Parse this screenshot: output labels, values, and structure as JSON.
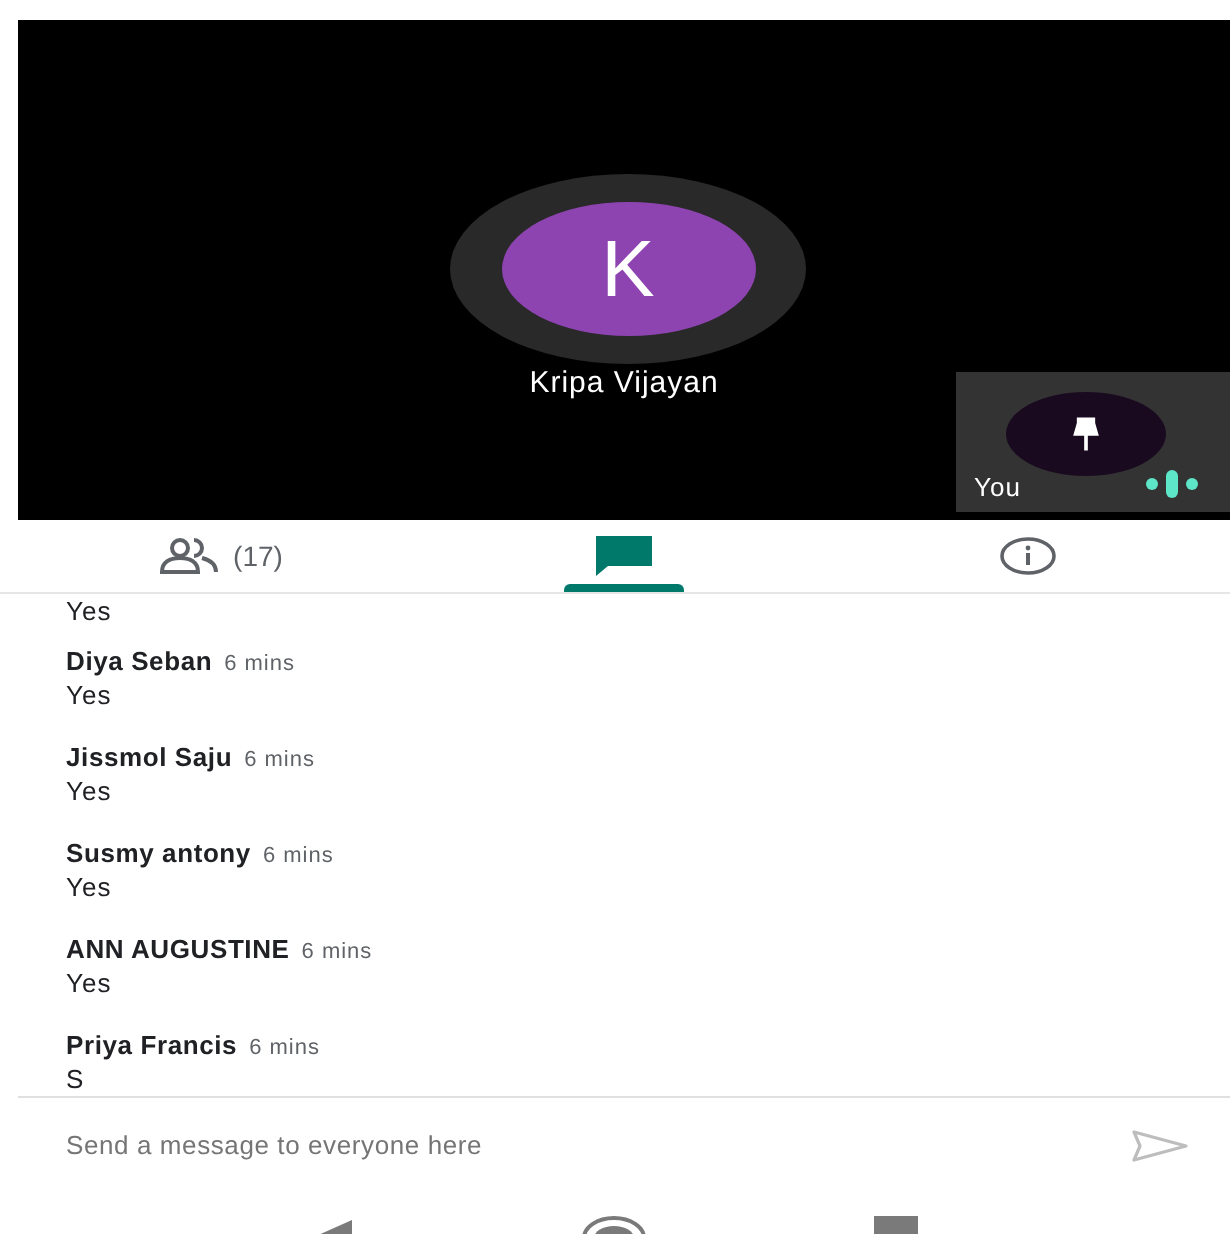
{
  "stage": {
    "speaker": {
      "initial": "K",
      "name": "Kripa Vijayan"
    },
    "self_tile": {
      "label": "You"
    }
  },
  "tabs": [
    {
      "kind": "people",
      "label": "(17)",
      "selected": false
    },
    {
      "kind": "chat",
      "selected": true
    },
    {
      "kind": "info",
      "selected": false
    }
  ],
  "messages": [
    {
      "text": "Yes"
    },
    {
      "sender": "Diya Seban",
      "time": "6 mins",
      "text": "Yes"
    },
    {
      "sender": "Jissmol Saju",
      "time": "6 mins",
      "text": "Yes"
    },
    {
      "sender": "Susmy antony",
      "time": "6 mins",
      "text": "Yes"
    },
    {
      "sender": "ANN AUGUSTINE",
      "time": "6 mins",
      "text": "Yes"
    },
    {
      "sender": "Priya Francis",
      "time": "6 mins",
      "text": "S"
    }
  ],
  "composer": {
    "placeholder": "Send a message to everyone here"
  }
}
